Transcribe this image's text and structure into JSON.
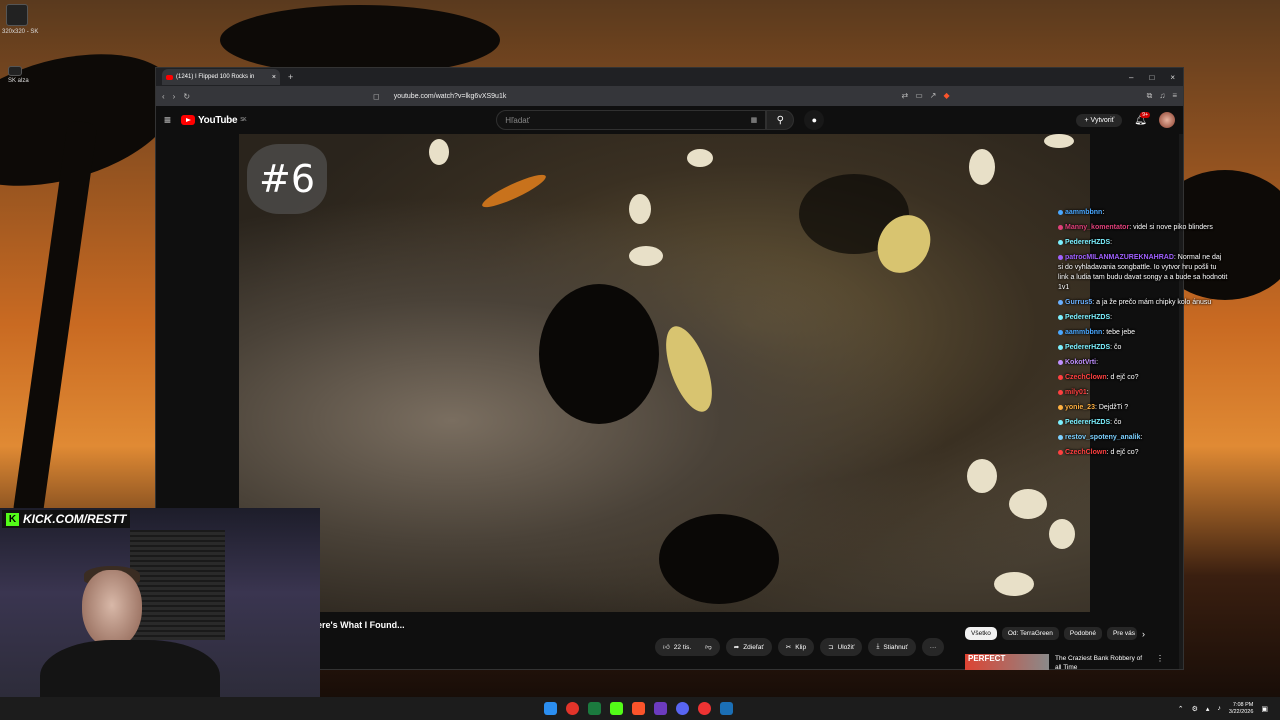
{
  "desktop": {
    "top_icon_label": "320x320 - SK",
    "second_icon_label": "SK alza"
  },
  "browser": {
    "tab_title": "(1241) I Flipped 100 Rocks in",
    "tab_close": "×",
    "new_tab": "+",
    "window_minimize": "–",
    "window_maximize": "□",
    "window_close": "×",
    "url": "youtube.com/watch?v=lkg6vXS9u1k"
  },
  "youtube": {
    "logo_text": "YouTube",
    "region_code": "SK",
    "search_placeholder": "Hľadať",
    "create_label": "Vytvoriť",
    "notifications_badge": "9+"
  },
  "video": {
    "overlay_number": "#6",
    "title_visible": "ere's What I Found...",
    "accent_color": "#ff0000"
  },
  "actions": {
    "likes": "22 tis.",
    "share": "Zdieľať",
    "clip": "Klip",
    "save": "Uložiť",
    "download": "Stiahnuť",
    "more": "···"
  },
  "chips": [
    {
      "label": "Všetko",
      "active": true
    },
    {
      "label": "Od: TerraGreen",
      "active": false
    },
    {
      "label": "Podobné",
      "active": false
    },
    {
      "label": "Pre vás",
      "active": false
    }
  ],
  "recommendation": {
    "thumb_text": "PERFECT",
    "title": "The Craziest Bank Robbery of all Time"
  },
  "chat": [
    {
      "user": "aammbbnn",
      "user_color": "#4aa8ff",
      "text": ""
    },
    {
      "user": "Manny_komentator",
      "user_color": "#e0407a",
      "text": "videl si nove piko blinders"
    },
    {
      "user": "PedererHZDS",
      "user_color": "#7cf0ff",
      "text": ""
    },
    {
      "user": "patrocMILANMAZUREKNAHRAD",
      "user_color": "#a060ff",
      "text": "Normal ne daj si do vyhladavania songbattle. Io vytvor hru pošli tu link a ludia tam budu davat songy a a bude sa hodnotit 1v1"
    },
    {
      "user": "Gurrus5",
      "user_color": "#6ab0ff",
      "text": "a ja že prečo mám chipky kolo ánusu"
    },
    {
      "user": "PedererHZDS",
      "user_color": "#7cf0ff",
      "text": ""
    },
    {
      "user": "aammbbnn",
      "user_color": "#4aa8ff",
      "text": "tebe jebe"
    },
    {
      "user": "PedererHZDS",
      "user_color": "#7cf0ff",
      "text": "čo"
    },
    {
      "user": "KokotVrti",
      "user_color": "#c090ff",
      "text": ""
    },
    {
      "user": "CzechClown",
      "user_color": "#ff4040",
      "text": "d ejč co?"
    },
    {
      "user": "mily01",
      "user_color": "#ff4040",
      "text": ""
    },
    {
      "user": "yonie_23",
      "user_color": "#ffb040",
      "text": "DejdžTi ?"
    },
    {
      "user": "PedererHZDS",
      "user_color": "#7cf0ff",
      "text": "čo"
    },
    {
      "user": "restov_spoteny_analik",
      "user_color": "#7cd0ff",
      "text": ""
    },
    {
      "user": "CzechClown",
      "user_color": "#ff4040",
      "text": "d ejč co?"
    }
  ],
  "stream": {
    "kick_url": "KICK.COM/RESTT",
    "kick_color": "#53fc18"
  },
  "taskbar": {
    "time": "7:08 PM",
    "date": "3/22/2026"
  }
}
